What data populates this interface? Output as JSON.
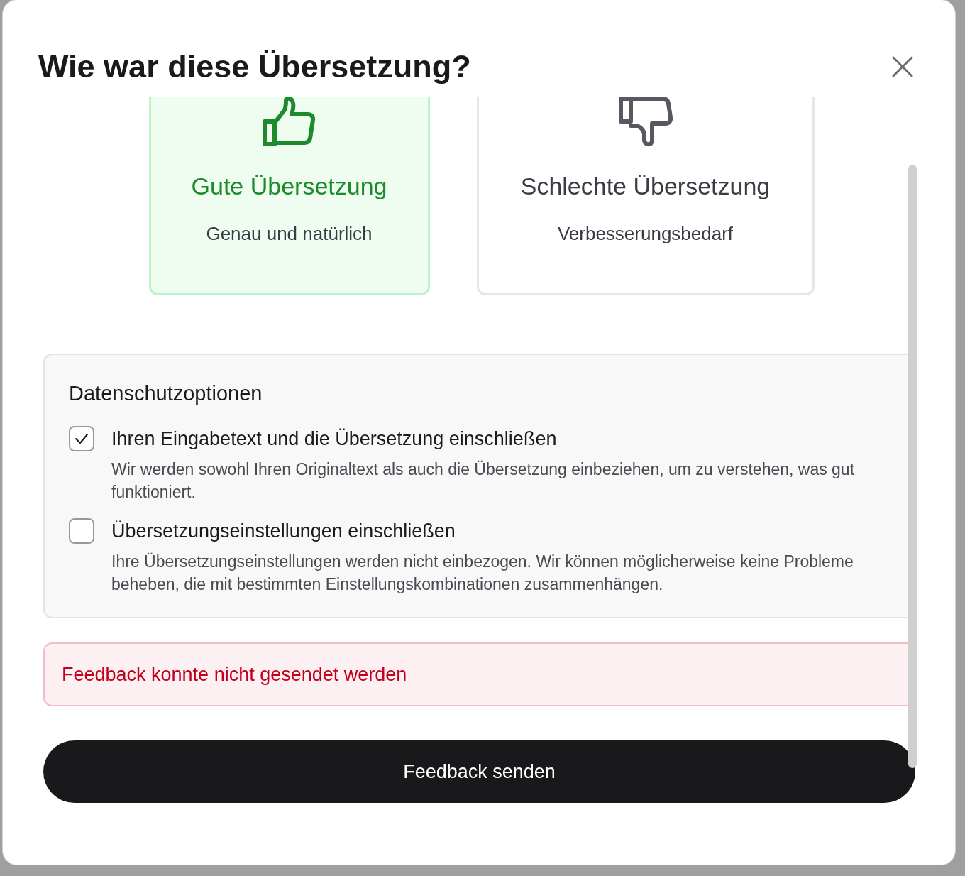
{
  "dialog": {
    "title": "Wie war diese Übersetzung?"
  },
  "ratings": [
    {
      "kind": "good",
      "title": "Gute Übersetzung",
      "subtitle": "Genau und natürlich",
      "selected": true
    },
    {
      "kind": "bad",
      "title": "Schlechte Übersetzung",
      "subtitle": "Verbesserungsbedarf",
      "selected": false
    }
  ],
  "privacy": {
    "heading": "Datenschutzoptionen",
    "options": [
      {
        "label": "Ihren Eingabetext und die Übersetzung einschließen",
        "description": "Wir werden sowohl Ihren Originaltext als auch die Übersetzung einbeziehen, um zu verstehen, was gut funktioniert.",
        "checked": true
      },
      {
        "label": "Übersetzungseinstellungen einschließen",
        "description": "Ihre Übersetzungseinstellungen werden nicht einbezogen. Wir können möglicherweise keine Probleme beheben, die mit bestimmten Einstellungskombinationen zusammenhängen.",
        "checked": false
      }
    ]
  },
  "error": "Feedback konnte nicht gesendet werden",
  "submit_button": "Feedback senden"
}
